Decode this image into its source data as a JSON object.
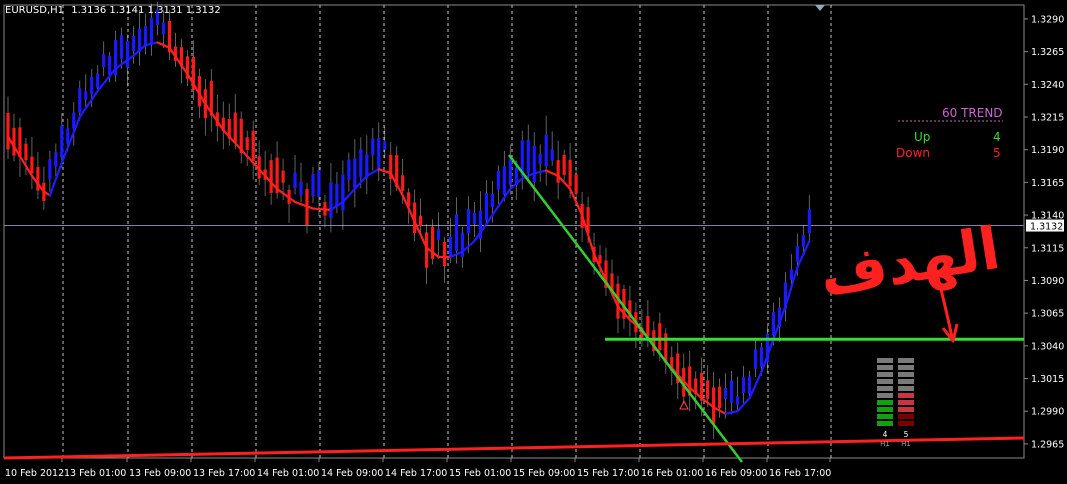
{
  "header": {
    "symbol": "EURUSD,H1",
    "quote": "1.3136 1.3141 1.3131 1.3132"
  },
  "colors": {
    "background": "#000000",
    "bull_candle": "#1a1aff",
    "bear_candle": "#ff1a1a",
    "ma_down": "#ff2020",
    "ma_up": "#1c1cff",
    "trendline": "#33cc33",
    "target_line": "#33dd33",
    "bottom_line": "#ff2020",
    "grid": "#d8d8d8",
    "axis_text": "#ffffff",
    "trend_title": "#cc66cc",
    "up_text": "#33dd33",
    "down_text": "#ff2020",
    "annotation": "#ff2020"
  },
  "trend_panel": {
    "title": "60 TREND",
    "up_label": "Up",
    "up_value": "4",
    "down_label": "Down",
    "down_value": "5"
  },
  "strength_meter": {
    "up_count": "4",
    "up_tf": "H1",
    "down_count": "5",
    "down_tf": "H1",
    "up_level": 4,
    "down_level": 5,
    "total_levels": 10
  },
  "annotation": {
    "text": "الهدف"
  },
  "current_price": "1.3132",
  "chart_data": {
    "type": "line",
    "title": "EURUSD,H1",
    "ylim": [
      1.2955,
      1.3305
    ],
    "y_ticks": [
      "1.3290",
      "1.3265",
      "1.3240",
      "1.3215",
      "1.3190",
      "1.3165",
      "1.3140",
      "1.3115",
      "1.3090",
      "1.3065",
      "1.3040",
      "1.3015",
      "1.2990",
      "1.2965"
    ],
    "x_ticks": [
      "10 Feb 2012",
      "13 Feb 01:00",
      "13 Feb 09:00",
      "13 Feb 17:00",
      "14 Feb 01:00",
      "14 Feb 09:00",
      "14 Feb 17:00",
      "15 Feb 01:00",
      "15 Feb 09:00",
      "15 Feb 17:00",
      "16 Feb 01:00",
      "16 Feb 09:00",
      "16 Feb 17:00"
    ],
    "current_price": 1.3132,
    "target_level": 1.3045,
    "series": [
      {
        "name": "",
        "values": [
          [
            0,
            1.32
          ],
          [
            2,
            1.3185
          ],
          [
            4,
            1.317
          ],
          [
            6,
            1.3158
          ],
          [
            7,
            1.3155
          ],
          [
            9,
            1.318
          ],
          [
            12,
            1.3215
          ],
          [
            15,
            1.3235
          ],
          [
            18,
            1.3252
          ],
          [
            21,
            1.3262
          ],
          [
            23,
            1.327
          ],
          [
            25,
            1.3272
          ],
          [
            27,
            1.3268
          ],
          [
            30,
            1.3248
          ],
          [
            33,
            1.3225
          ],
          [
            36,
            1.3205
          ],
          [
            39,
            1.319
          ],
          [
            42,
            1.3175
          ],
          [
            45,
            1.316
          ],
          [
            48,
            1.315
          ],
          [
            51,
            1.3145
          ],
          [
            54,
            1.3144
          ],
          [
            56,
            1.315
          ],
          [
            58,
            1.316
          ],
          [
            60,
            1.317
          ],
          [
            62,
            1.3175
          ],
          [
            64,
            1.3172
          ],
          [
            66,
            1.3155
          ],
          [
            68,
            1.3135
          ],
          [
            70,
            1.3115
          ],
          [
            72,
            1.3108
          ],
          [
            74,
            1.3108
          ],
          [
            76,
            1.3112
          ],
          [
            78,
            1.312
          ],
          [
            81,
            1.314
          ],
          [
            84,
            1.316
          ],
          [
            86,
            1.3168
          ],
          [
            88,
            1.3172
          ],
          [
            90,
            1.3174
          ],
          [
            92,
            1.317
          ],
          [
            94,
            1.316
          ],
          [
            96,
            1.314
          ],
          [
            98,
            1.311
          ],
          [
            100,
            1.309
          ],
          [
            102,
            1.307
          ],
          [
            104,
            1.306
          ],
          [
            106,
            1.3052
          ],
          [
            108,
            1.304
          ],
          [
            110,
            1.3028
          ],
          [
            112,
            1.3018
          ],
          [
            114,
            1.3008
          ],
          [
            116,
            1.3
          ],
          [
            118,
            1.2993
          ],
          [
            120,
            1.2988
          ],
          [
            122,
            1.299
          ],
          [
            124,
            1.3
          ],
          [
            126,
            1.302
          ],
          [
            128,
            1.3045
          ],
          [
            130,
            1.307
          ],
          [
            132,
            1.31
          ],
          [
            134,
            1.312
          ]
        ]
      }
    ],
    "annotations": [
      "60 TREND",
      "Up 4",
      "Down 5",
      "الهدف"
    ]
  }
}
